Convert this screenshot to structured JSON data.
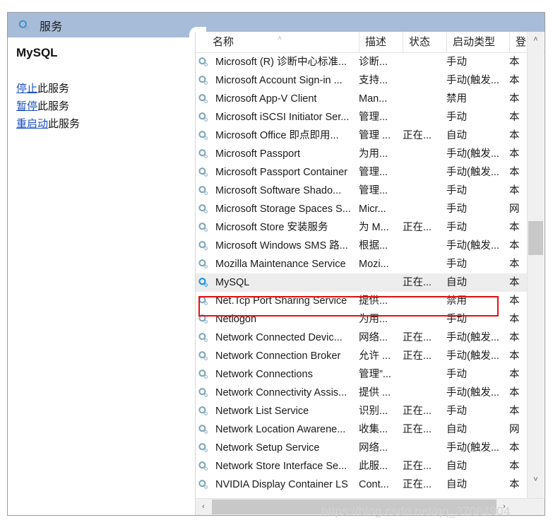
{
  "window": {
    "title": "服务",
    "title_icon": "services-gear-icon"
  },
  "detail_pane": {
    "service_name": "MySQL",
    "actions": [
      {
        "link": "停止",
        "tail": "此服务"
      },
      {
        "link": "暂停",
        "tail": "此服务"
      },
      {
        "link": "重启动",
        "tail": "此服务"
      }
    ]
  },
  "list": {
    "sort_indicator": "˄",
    "columns": [
      {
        "key": "name",
        "label": "名称"
      },
      {
        "key": "desc",
        "label": "描述"
      },
      {
        "key": "state",
        "label": "状态"
      },
      {
        "key": "start",
        "label": "启动类型"
      },
      {
        "key": "logon",
        "label": "登"
      }
    ],
    "rows": [
      {
        "name": "Microsoft (R) 诊断中心标准...",
        "desc": "诊断...",
        "state": "",
        "start": "手动",
        "logon": "本"
      },
      {
        "name": "Microsoft Account Sign-in ...",
        "desc": "支持...",
        "state": "",
        "start": "手动(触发...",
        "logon": "本"
      },
      {
        "name": "Microsoft App-V Client",
        "desc": "Man...",
        "state": "",
        "start": "禁用",
        "logon": "本"
      },
      {
        "name": "Microsoft iSCSI Initiator Ser...",
        "desc": "管理...",
        "state": "",
        "start": "手动",
        "logon": "本"
      },
      {
        "name": "Microsoft Office 即点即用...",
        "desc": "管理 ...",
        "state": "正在...",
        "start": "自动",
        "logon": "本"
      },
      {
        "name": "Microsoft Passport",
        "desc": "为用...",
        "state": "",
        "start": "手动(触发...",
        "logon": "本"
      },
      {
        "name": "Microsoft Passport Container",
        "desc": "管理...",
        "state": "",
        "start": "手动(触发...",
        "logon": "本"
      },
      {
        "name": "Microsoft Software Shado...",
        "desc": "管理...",
        "state": "",
        "start": "手动",
        "logon": "本"
      },
      {
        "name": "Microsoft Storage Spaces S...",
        "desc": "Micr...",
        "state": "",
        "start": "手动",
        "logon": "网"
      },
      {
        "name": "Microsoft Store 安装服务",
        "desc": "为 M...",
        "state": "正在...",
        "start": "手动",
        "logon": "本"
      },
      {
        "name": "Microsoft Windows SMS 路...",
        "desc": "根据...",
        "state": "",
        "start": "手动(触发...",
        "logon": "本"
      },
      {
        "name": "Mozilla Maintenance Service",
        "desc": "Mozi...",
        "state": "",
        "start": "手动",
        "logon": "本"
      },
      {
        "name": "MySQL",
        "desc": "",
        "state": "正在...",
        "start": "自动",
        "logon": "本",
        "selected": true
      },
      {
        "name": "Net.Tcp Port Sharing Service",
        "desc": "提供...",
        "state": "",
        "start": "禁用",
        "logon": "本"
      },
      {
        "name": "Netlogon",
        "desc": "为用...",
        "state": "",
        "start": "手动",
        "logon": "本"
      },
      {
        "name": "Network Connected Devic...",
        "desc": "网络...",
        "state": "正在...",
        "start": "手动(触发...",
        "logon": "本"
      },
      {
        "name": "Network Connection Broker",
        "desc": "允许 ...",
        "state": "正在...",
        "start": "手动(触发...",
        "logon": "本"
      },
      {
        "name": "Network Connections",
        "desc": "管理”...",
        "state": "",
        "start": "手动",
        "logon": "本"
      },
      {
        "name": "Network Connectivity Assis...",
        "desc": "提供 ...",
        "state": "",
        "start": "手动(触发...",
        "logon": "本"
      },
      {
        "name": "Network List Service",
        "desc": "识别...",
        "state": "正在...",
        "start": "手动",
        "logon": "本"
      },
      {
        "name": "Network Location Awarene...",
        "desc": "收集...",
        "state": "正在...",
        "start": "自动",
        "logon": "网"
      },
      {
        "name": "Network Setup Service",
        "desc": "网络...",
        "state": "",
        "start": "手动(触发...",
        "logon": "本"
      },
      {
        "name": "Network Store Interface Se...",
        "desc": "此服...",
        "state": "正在...",
        "start": "自动",
        "logon": "本"
      },
      {
        "name": "NVIDIA Display Container LS",
        "desc": "Cont...",
        "state": "正在...",
        "start": "自动",
        "logon": "本"
      }
    ]
  },
  "scrollbars": {
    "v_up": "˄",
    "v_down": "˅",
    "h_left": "‹",
    "h_right": "›"
  },
  "annotation": {
    "highlight_target": "MySQL",
    "color": "#e81010"
  },
  "watermark": {
    "text": "https://blog.csdn.net/qq_37084904"
  }
}
